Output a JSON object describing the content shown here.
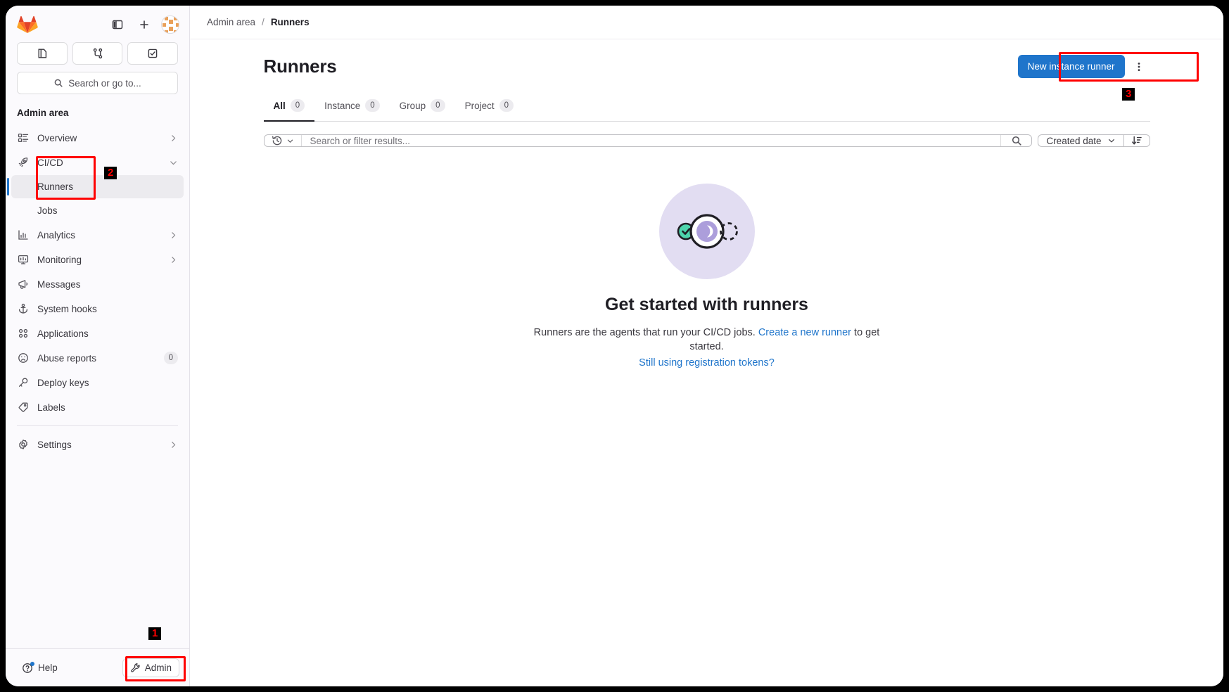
{
  "window": {
    "brand_color": "#e24329",
    "accent_color": "#1f75cb"
  },
  "sidebar": {
    "logo_name": "gitlab-logo",
    "top_icons": [
      {
        "name": "sidebar-toggle-icon",
        "label": "Toggle sidebar"
      },
      {
        "name": "plus-icon",
        "label": "Create new"
      },
      {
        "name": "user-avatar",
        "label": "User menu"
      }
    ],
    "quick_actions": [
      {
        "name": "issues-icon",
        "label": "Issues"
      },
      {
        "name": "merge-requests-icon",
        "label": "Merge requests"
      },
      {
        "name": "todos-icon",
        "label": "To-Do list"
      }
    ],
    "search": {
      "placeholder": "Search or go to...",
      "icon": "search-icon"
    },
    "context_label": "Admin area",
    "items": [
      {
        "label": "Overview",
        "icon": "overview-icon",
        "chevron": "right",
        "badge": null,
        "children": []
      },
      {
        "label": "CI/CD",
        "icon": "rocket-icon",
        "chevron": "down",
        "badge": null,
        "children": [
          {
            "label": "Runners",
            "active": true
          },
          {
            "label": "Jobs",
            "active": false
          }
        ]
      },
      {
        "label": "Analytics",
        "icon": "chart-icon",
        "chevron": "right",
        "badge": null,
        "children": []
      },
      {
        "label": "Monitoring",
        "icon": "monitor-icon",
        "chevron": "right",
        "badge": null,
        "children": []
      },
      {
        "label": "Messages",
        "icon": "megaphone-icon",
        "chevron": null,
        "badge": null,
        "children": []
      },
      {
        "label": "System hooks",
        "icon": "anchor-icon",
        "chevron": null,
        "badge": null,
        "children": []
      },
      {
        "label": "Applications",
        "icon": "applications-icon",
        "chevron": null,
        "badge": null,
        "children": []
      },
      {
        "label": "Abuse reports",
        "icon": "frown-icon",
        "chevron": null,
        "badge": "0",
        "children": []
      },
      {
        "label": "Deploy keys",
        "icon": "key-icon",
        "chevron": null,
        "badge": null,
        "children": []
      },
      {
        "label": "Labels",
        "icon": "label-icon",
        "chevron": null,
        "badge": null,
        "children": []
      }
    ],
    "settings_item": {
      "label": "Settings",
      "icon": "gear-icon",
      "chevron": "right"
    },
    "bottom": {
      "help_label": "Help",
      "help_icon": "question-circle-icon",
      "help_has_notification": true,
      "admin_label": "Admin",
      "admin_icon": "wrench-icon"
    }
  },
  "breadcrumb": {
    "root": "Admin area",
    "separator": "/",
    "current": "Runners"
  },
  "header": {
    "title": "Runners",
    "primary_button": "New instance runner",
    "kebab_name": "more-actions-icon"
  },
  "tabs": [
    {
      "label": "All",
      "count": "0",
      "active": true
    },
    {
      "label": "Instance",
      "count": "0",
      "active": false
    },
    {
      "label": "Group",
      "count": "0",
      "active": false
    },
    {
      "label": "Project",
      "count": "0",
      "active": false
    }
  ],
  "filters": {
    "history_icon": "history-icon",
    "search_placeholder": "Search or filter results...",
    "search_value": "",
    "search_icon": "search-icon",
    "sort_value": "Created date",
    "sort_direction_icon": "sort-descending-icon"
  },
  "empty_state": {
    "illustration_name": "runners-empty-illustration",
    "title": "Get started with runners",
    "description_prefix": "Runners are the agents that run your CI/CD jobs.",
    "description_link": "Create a new runner",
    "description_suffix": "to get started.",
    "secondary_link": "Still using registration tokens?"
  },
  "annotations": [
    {
      "number": "1",
      "target": "admin-button"
    },
    {
      "number": "2",
      "target": "cicd-runners-nav"
    },
    {
      "number": "3",
      "target": "new-instance-runner-button"
    }
  ]
}
